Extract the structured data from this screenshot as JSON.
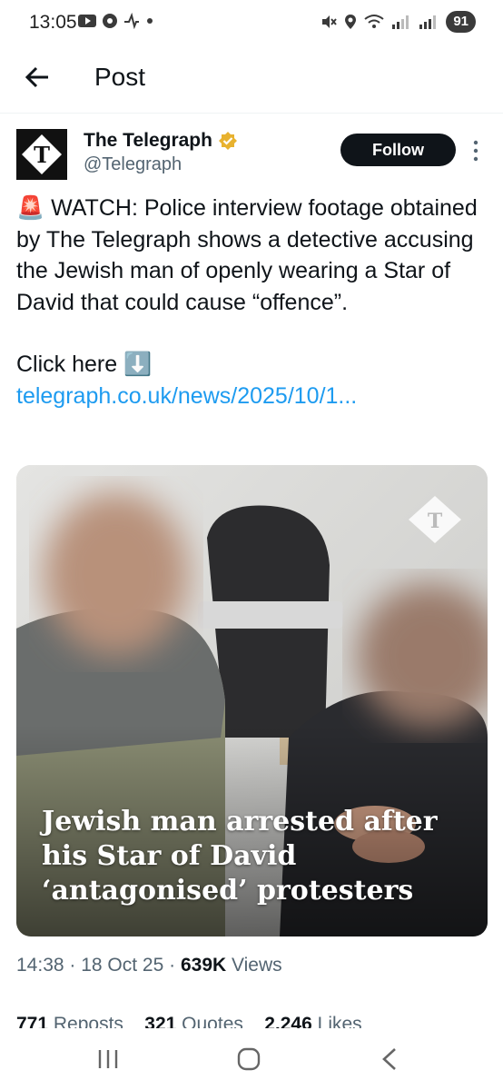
{
  "status_bar": {
    "time": "13:05",
    "battery": "91"
  },
  "header": {
    "title": "Post"
  },
  "post": {
    "author_name": "The Telegraph",
    "author_handle": "@Telegraph",
    "follow_label": "Follow",
    "text_line1": "🚨 WATCH: Police interview footage obtained by The Telegraph shows a detective accusing the Jewish man of openly wearing a Star of David that could cause “offence”.",
    "text_line2": "Click here ⬇️",
    "link": "telegraph.co.uk/news/2025/10/1...",
    "media_caption": "Jewish man arrested after his Star of David ‘antagonised’ protesters",
    "time": "14:38",
    "date": "18 Oct 25",
    "views_count": "639K",
    "views_label": "Views",
    "reposts_count": "771",
    "reposts_label": "Reposts",
    "quotes_count": "321",
    "quotes_label": "Quotes",
    "likes_count": "2,246",
    "likes_label": "Likes"
  },
  "colors": {
    "link": "#1d9bf0",
    "verified_badge": "#e8b22f",
    "follow_bg": "#0f1419"
  }
}
